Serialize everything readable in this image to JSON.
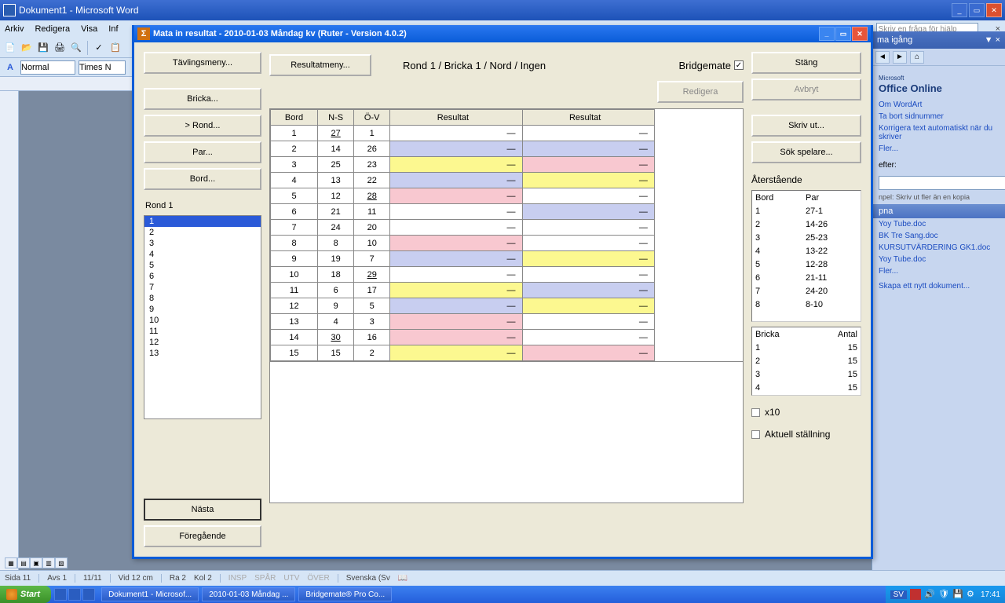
{
  "word": {
    "title": "Dokument1 - Microsoft Word",
    "menus": [
      "Arkiv",
      "Redigera",
      "Visa",
      "Inf"
    ],
    "help_placeholder": "Skriv en fråga för hjälp",
    "style": "Normal",
    "font": "Times N",
    "status": {
      "sida": "Sida  11",
      "avs": "Avs  1",
      "pages": "11/11",
      "vid": "Vid  12 cm",
      "ra": "Ra  2",
      "kol": "Kol  2",
      "insp": "INSP",
      "spar": "SPÅR",
      "utv": "UTV",
      "over": "ÖVER",
      "lang": "Svenska (Sv"
    }
  },
  "taskpane": {
    "title": "ma igång",
    "logo_top": "Microsoft",
    "logo": "Office Online",
    "links1": [
      "Om WordArt",
      "Ta bort sidnummer",
      "Korrigera text automatiskt när du skriver",
      "Fler..."
    ],
    "search_label": "efter:",
    "search_hint": "npel:  Skriv ut fler än en kopia",
    "open_header": "pna",
    "docs": [
      "Yoy Tube.doc",
      "BK Tre Sang.doc",
      "KURSUTVÄRDERING GK1.doc",
      "Yoy Tube.doc",
      "Fler..."
    ],
    "new_doc": "Skapa ett nytt dokument..."
  },
  "ruter": {
    "title": "Mata in resultat - 2010-01-03  Måndag kv  (Ruter - Version 4.0.2)",
    "left_buttons": [
      "Tävlingsmeny...",
      "Bricka...",
      ">     Rond...",
      "Par...",
      "Bord..."
    ],
    "rond_label": "Rond 1",
    "rond_items": [
      "1",
      "2",
      "3",
      "4",
      "5",
      "6",
      "7",
      "8",
      "9",
      "10",
      "11",
      "12",
      "13"
    ],
    "nasta": "Nästa",
    "foregaende": "Föregående",
    "resultatmeny": "Resultatmeny...",
    "breadcrumb": "Rond 1 / Bricka 1 / Nord / Ingen",
    "bridgemate": "Bridgemate",
    "redigera": "Redigera",
    "stang": "Stäng",
    "avbryt": "Avbryt",
    "skrivut": "Skriv ut...",
    "sokspelare": "Sök spelare...",
    "aterstaende": "Återstående",
    "remain_headers": [
      "Bord",
      "Par"
    ],
    "remaining": [
      {
        "bord": "1",
        "par": "27-1"
      },
      {
        "bord": "2",
        "par": "14-26"
      },
      {
        "bord": "3",
        "par": "25-23"
      },
      {
        "bord": "4",
        "par": "13-22"
      },
      {
        "bord": "5",
        "par": "12-28"
      },
      {
        "bord": "6",
        "par": "21-11"
      },
      {
        "bord": "7",
        "par": "24-20"
      },
      {
        "bord": "8",
        "par": "8-10"
      }
    ],
    "bricka_headers": [
      "Bricka",
      "Antal"
    ],
    "bricka_rows": [
      {
        "b": "1",
        "a": "15"
      },
      {
        "b": "2",
        "a": "15"
      },
      {
        "b": "3",
        "a": "15"
      },
      {
        "b": "4",
        "a": "15"
      }
    ],
    "x10": "x10",
    "aktuell": "Aktuell ställning",
    "table_headers": {
      "bord": "Bord",
      "ns": "N-S",
      "ov": "Ö-V",
      "res": "Resultat"
    },
    "rows": [
      {
        "bord": "1",
        "ns": "27",
        "ov": "1",
        "nsU": true,
        "ovU": false,
        "c1": "white",
        "c2": "white"
      },
      {
        "bord": "2",
        "ns": "14",
        "ov": "26",
        "nsU": false,
        "ovU": false,
        "c1": "blue",
        "c2": "blue"
      },
      {
        "bord": "3",
        "ns": "25",
        "ov": "23",
        "nsU": false,
        "ovU": false,
        "c1": "yellow",
        "c2": "pink"
      },
      {
        "bord": "4",
        "ns": "13",
        "ov": "22",
        "nsU": false,
        "ovU": false,
        "c1": "blue",
        "c2": "yellow"
      },
      {
        "bord": "5",
        "ns": "12",
        "ov": "28",
        "nsU": false,
        "ovU": true,
        "c1": "pink",
        "c2": "white"
      },
      {
        "bord": "6",
        "ns": "21",
        "ov": "11",
        "nsU": false,
        "ovU": false,
        "c1": "white",
        "c2": "blue"
      },
      {
        "bord": "7",
        "ns": "24",
        "ov": "20",
        "nsU": false,
        "ovU": false,
        "c1": "white",
        "c2": "white"
      },
      {
        "bord": "8",
        "ns": "8",
        "ov": "10",
        "nsU": false,
        "ovU": false,
        "c1": "pink",
        "c2": "white"
      },
      {
        "bord": "9",
        "ns": "19",
        "ov": "7",
        "nsU": false,
        "ovU": false,
        "c1": "blue",
        "c2": "yellow"
      },
      {
        "bord": "10",
        "ns": "18",
        "ov": "29",
        "nsU": false,
        "ovU": true,
        "c1": "white",
        "c2": "white"
      },
      {
        "bord": "11",
        "ns": "6",
        "ov": "17",
        "nsU": false,
        "ovU": false,
        "c1": "yellow",
        "c2": "blue"
      },
      {
        "bord": "12",
        "ns": "9",
        "ov": "5",
        "nsU": false,
        "ovU": false,
        "c1": "blue",
        "c2": "yellow"
      },
      {
        "bord": "13",
        "ns": "4",
        "ov": "3",
        "nsU": false,
        "ovU": false,
        "c1": "pink",
        "c2": "white"
      },
      {
        "bord": "14",
        "ns": "30",
        "ov": "16",
        "nsU": true,
        "ovU": false,
        "c1": "pink",
        "c2": "white"
      },
      {
        "bord": "15",
        "ns": "15",
        "ov": "2",
        "nsU": false,
        "ovU": false,
        "c1": "yellow",
        "c2": "pink"
      }
    ]
  },
  "taskbar": {
    "start": "Start",
    "tasks": [
      "Dokument1 - Microsof...",
      "2010-01-03  Måndag ...",
      "Bridgemate® Pro Co..."
    ],
    "lang": "SV",
    "clock": "17:41"
  }
}
